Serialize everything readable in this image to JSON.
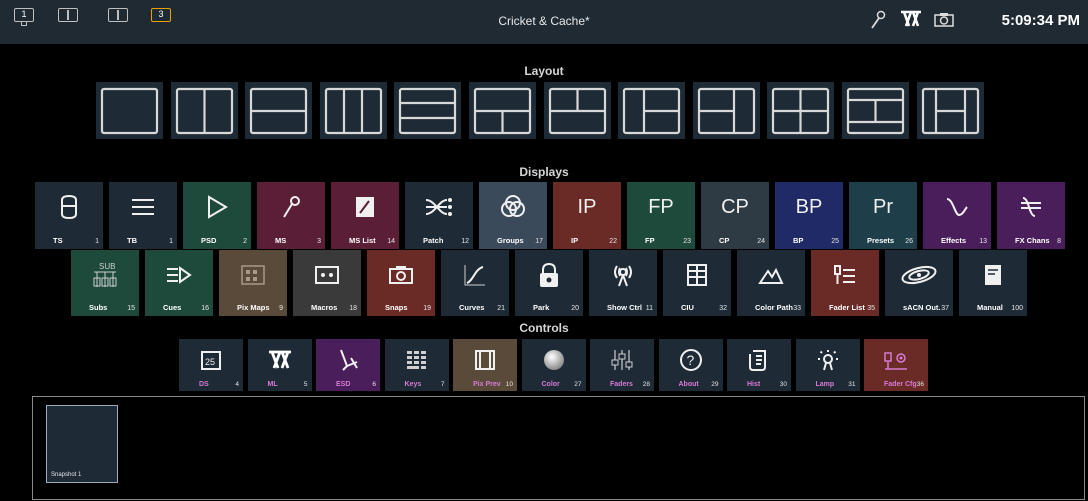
{
  "topbar": {
    "title": "Cricket & Cache*",
    "workspaces": [
      "1",
      "",
      "",
      "3"
    ],
    "clock": "5:09:34 PM",
    "icons": [
      "monitor-icon",
      "split-screen-icon",
      "split-screen-icon",
      "workspace-3-icon",
      "magic-sheet-icon",
      "ml-logo-icon",
      "camera-icon"
    ]
  },
  "layout": {
    "title": "Layout",
    "tiles": [
      "single",
      "vertical-2",
      "horizontal-2",
      "vertical-3",
      "horizontal-3",
      "top-1-bottom-2",
      "top-2-bottom-1",
      "left-1-right-2",
      "left-2-right-1",
      "quad",
      "top-bottom-middle",
      "left-right-middle"
    ]
  },
  "displays": {
    "title": "Displays",
    "row1": [
      {
        "label": "TS",
        "num": "1",
        "icon": "cylinder-icon",
        "color": "#1e2a35"
      },
      {
        "label": "TB",
        "num": "1",
        "icon": "list-icon",
        "color": "#1e2a35"
      },
      {
        "label": "PSD",
        "num": "2",
        "icon": "play-icon",
        "color": "#1e4a3c"
      },
      {
        "label": "MS",
        "num": "3",
        "icon": "wand-icon",
        "color": "#5a1f36"
      },
      {
        "label": "MS List",
        "num": "14",
        "icon": "wand-list-icon",
        "color": "#5a1f36"
      },
      {
        "label": "Patch",
        "num": "12",
        "icon": "patch-icon",
        "color": "#1e2a35"
      },
      {
        "label": "Groups",
        "num": "17",
        "icon": "groups-icon",
        "color": "#3a4a5a"
      },
      {
        "label": "IP",
        "num": "22",
        "icon": "IP",
        "color": "#6a2a25"
      },
      {
        "label": "FP",
        "num": "23",
        "icon": "FP",
        "color": "#1e4a3c"
      },
      {
        "label": "CP",
        "num": "24",
        "icon": "CP",
        "color": "#2e3a44"
      },
      {
        "label": "BP",
        "num": "25",
        "icon": "BP",
        "color": "#1f2a66"
      },
      {
        "label": "Presets",
        "num": "26",
        "icon": "Pr",
        "color": "#1e3f4a"
      },
      {
        "label": "Effects",
        "num": "13",
        "icon": "sine-icon",
        "color": "#4a1e5a"
      },
      {
        "label": "FX Chans",
        "num": "8",
        "icon": "fx-chans-icon",
        "color": "#4a1e5a"
      }
    ],
    "row2": [
      {
        "label": "Subs",
        "num": "15",
        "icon": "subs-icon",
        "color": "#1e4a3c"
      },
      {
        "label": "Cues",
        "num": "16",
        "icon": "cues-icon",
        "color": "#1e4a3c"
      },
      {
        "label": "Pix Maps",
        "num": "9",
        "icon": "pixmap-icon",
        "color": "#5a4a3a"
      },
      {
        "label": "Macros",
        "num": "18",
        "icon": "macro-icon",
        "color": "#3a3a3a"
      },
      {
        "label": "Snaps",
        "num": "19",
        "icon": "camera-icon",
        "color": "#6a2a25"
      },
      {
        "label": "Curves",
        "num": "21",
        "icon": "curve-icon",
        "color": "#1e2a35"
      },
      {
        "label": "Park",
        "num": "20",
        "icon": "lock-icon",
        "color": "#1e2a35"
      },
      {
        "label": "Show Ctrl",
        "num": "11",
        "icon": "antenna-icon",
        "color": "#1e2a35"
      },
      {
        "label": "CIU",
        "num": "32",
        "icon": "ciu-icon",
        "color": "#1e2a35"
      },
      {
        "label": "Color Path",
        "num": "33",
        "icon": "color-path-icon",
        "color": "#1e2a35"
      },
      {
        "label": "Fader List",
        "num": "35",
        "icon": "fader-list-icon",
        "color": "#6a2a25"
      },
      {
        "label": "sACN Out.",
        "num": "37",
        "icon": "galaxy-icon",
        "color": "#1e2a35"
      },
      {
        "label": "Manual",
        "num": "100",
        "icon": "manual-icon",
        "color": "#1e2a35"
      }
    ]
  },
  "controls": {
    "title": "Controls",
    "items": [
      {
        "label": "DS",
        "num": "4",
        "icon": "calendar-25-icon",
        "color": "#1e2a35"
      },
      {
        "label": "ML",
        "num": "5",
        "icon": "ml-logo-icon",
        "color": "#1e2a35"
      },
      {
        "label": "ESD",
        "num": "6",
        "icon": "esd-icon",
        "color": "#4a1e5a"
      },
      {
        "label": "Keys",
        "num": "7",
        "icon": "keypad-icon",
        "color": "#1e2a35"
      },
      {
        "label": "Pix Prev",
        "num": "10",
        "icon": "film-icon",
        "color": "#5a4a3a"
      },
      {
        "label": "Color",
        "num": "27",
        "icon": "color-ball-icon",
        "color": "#1e2a35"
      },
      {
        "label": "Faders",
        "num": "28",
        "icon": "faders-icon",
        "color": "#1e2a35"
      },
      {
        "label": "About",
        "num": "29",
        "icon": "question-icon",
        "color": "#1e2a35"
      },
      {
        "label": "Hist",
        "num": "30",
        "icon": "scroll-icon",
        "color": "#1e2a35"
      },
      {
        "label": "Lamp",
        "num": "31",
        "icon": "lamp-icon",
        "color": "#1e2a35"
      },
      {
        "label": "Fader Cfg",
        "num": "36",
        "icon": "fader-config-icon",
        "color": "#6a2a25"
      }
    ]
  },
  "snapshots": {
    "items": [
      {
        "label": "Snapshot 1"
      }
    ]
  }
}
